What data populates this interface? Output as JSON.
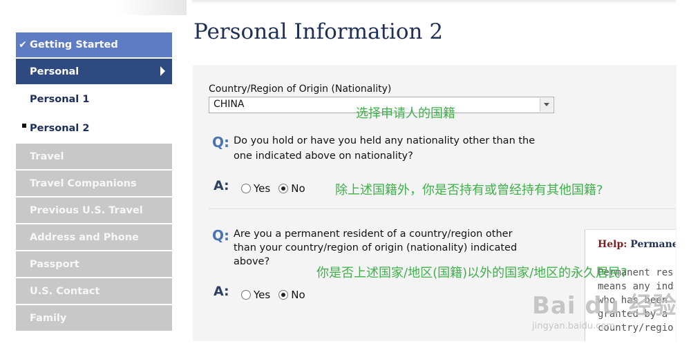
{
  "sidebar": {
    "items": [
      {
        "label": "Getting Started",
        "state": "completed"
      },
      {
        "label": "Personal",
        "state": "active"
      },
      {
        "label": "Personal 1",
        "state": "sub"
      },
      {
        "label": "Personal 2",
        "state": "sub-current"
      },
      {
        "label": "Travel",
        "state": "disabled"
      },
      {
        "label": "Travel Companions",
        "state": "disabled"
      },
      {
        "label": "Previous U.S. Travel",
        "state": "disabled"
      },
      {
        "label": "Address and Phone",
        "state": "disabled"
      },
      {
        "label": "Passport",
        "state": "disabled"
      },
      {
        "label": "U.S. Contact",
        "state": "disabled"
      },
      {
        "label": "Family",
        "state": "disabled"
      }
    ]
  },
  "page": {
    "title": "Personal Information 2"
  },
  "form": {
    "nationality": {
      "label": "Country/Region of Origin (Nationality)",
      "value": "CHINA"
    },
    "questions": [
      {
        "q_marker": "Q:",
        "text_line1": "Do you hold or have you held any nationality other than the",
        "text_line2": "one indicated above on nationality?",
        "a_marker": "A:",
        "options": [
          "Yes",
          "No"
        ],
        "selected": "No"
      },
      {
        "q_marker": "Q:",
        "text_line1": "Are you a permanent resident of a country/region other",
        "text_line2": "than your country/region of origin (nationality) indicated",
        "text_line3": "above?",
        "a_marker": "A:",
        "options": [
          "Yes",
          "No"
        ],
        "selected": "No"
      }
    ]
  },
  "help": {
    "title_prefix": "Help:",
    "title_rest": "Permane",
    "body": "Permanent res\nmeans any ind\nwho has been\ngranted by a\ncountry/regio"
  },
  "annotations": {
    "nationality": "选择申请人的国籍",
    "q1": "除上述国籍外，你是否持有或曾经持有其他国籍?",
    "q2": "你是否上述国家/地区(国籍)以外的国家/地区的永久居民?"
  },
  "watermark": {
    "brand": "Bai du 经验",
    "url": "jingyan.baidu.com"
  },
  "colors": {
    "sidebar_started": "#5d7cc4",
    "sidebar_active": "#2e4a80",
    "sidebar_disabled": "#c8c8c8",
    "annotation_green": "#3fb04a",
    "q_blue": "#4b74b5"
  }
}
